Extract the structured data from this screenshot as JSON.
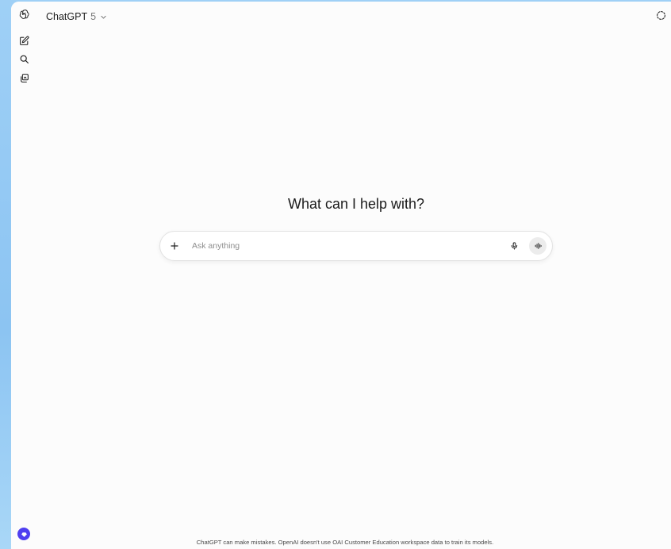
{
  "header": {
    "model_name": "ChatGPT",
    "model_version": "5"
  },
  "sidebar": {
    "items": [
      {
        "icon": "openai-logo-icon"
      },
      {
        "icon": "new-chat-icon"
      },
      {
        "icon": "search-icon"
      },
      {
        "icon": "library-icon"
      }
    ]
  },
  "main": {
    "headline": "What can I help with?"
  },
  "composer": {
    "placeholder": "Ask anything",
    "value": ""
  },
  "footer": {
    "disclaimer": "ChatGPT can make mistakes. OpenAI doesn't use OAI Customer Education workspace data to train its models."
  },
  "colors": {
    "desktop_background": "#9fd0f6",
    "window_background": "#fcfcfc",
    "badge_accent": "#4f3ff0",
    "voice_button_bg": "#ececec"
  }
}
